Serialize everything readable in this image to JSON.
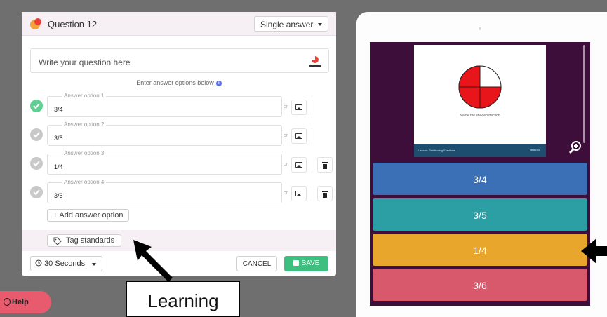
{
  "editor": {
    "question_title": "Question 12",
    "question_type": "Single answer",
    "question_placeholder": "Write your question here",
    "hint": "Enter answer options below",
    "options": [
      {
        "legend": "Answer option 1",
        "value": "3/4",
        "correct": true,
        "deletable": false
      },
      {
        "legend": "Answer option 2",
        "value": "3/5",
        "correct": false,
        "deletable": false
      },
      {
        "legend": "Answer option 3",
        "value": "1/4",
        "correct": false,
        "deletable": true
      },
      {
        "legend": "Answer option 4",
        "value": "3/6",
        "correct": false,
        "deletable": true
      }
    ],
    "or_text": "or",
    "add_option_label": "+ Add answer option",
    "tag_standards_label": "Tag standards",
    "time_label": "30 Seconds",
    "cancel_label": "CANCEL",
    "save_label": "SAVE"
  },
  "help": {
    "label": "Help"
  },
  "annotation": {
    "label": "Learning"
  },
  "preview": {
    "slide_caption": "Name the shaded fraction",
    "slide_footer_left": "Lesson: Partitioning Fractions",
    "slide_footer_right": "nearpod",
    "fraction_shaded": 0.75,
    "answers": [
      {
        "label": "3/4",
        "color": "#3b6fb6"
      },
      {
        "label": "3/5",
        "color": "#2b9fa3"
      },
      {
        "label": "1/4",
        "color": "#e8a62d"
      },
      {
        "label": "3/6",
        "color": "#d9596c"
      }
    ]
  },
  "colors": {
    "correct": "#5fcf94",
    "save": "#3fbf7f",
    "help": "#e85a6e",
    "screen_bg": "#3e0e3a"
  }
}
